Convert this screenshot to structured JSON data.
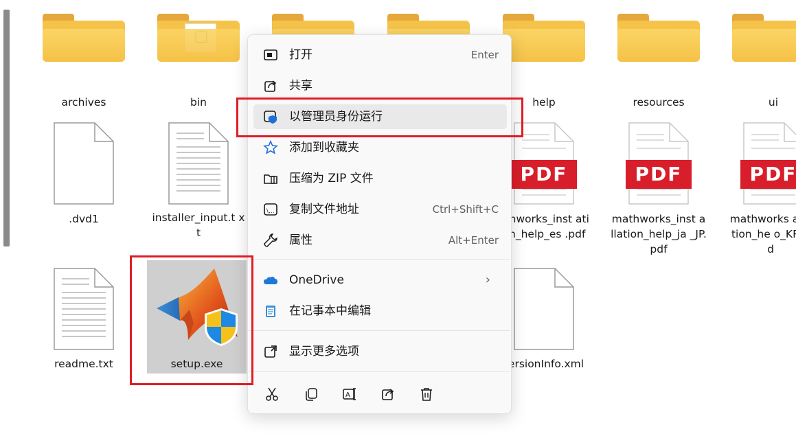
{
  "files": {
    "folders": [
      {
        "label": "archives"
      },
      {
        "label": "bin"
      },
      {
        "label": ""
      },
      {
        "label": ""
      },
      {
        "label": "help"
      },
      {
        "label": "resources"
      },
      {
        "label": "ui"
      }
    ],
    "dvd1": ".dvd1",
    "installer_input": "installer_input.t xt",
    "pdf_badge": "PDF",
    "pdf_es": "athworks_inst ation_help_es .pdf",
    "pdf_ja": "mathworks_inst allation_help_ja _JP.pdf",
    "pdf_ko": "mathworks allation_he o_KR.pd",
    "readme": "readme.txt",
    "setup": "setup.exe",
    "versioninfo": "ersionInfo.xml"
  },
  "context_menu": {
    "items": [
      {
        "icon": "open-icon",
        "label": "打开",
        "shortcut": "Enter"
      },
      {
        "icon": "share-icon",
        "label": "共享",
        "shortcut": ""
      },
      {
        "icon": "admin-shield-icon",
        "label": "以管理员身份运行",
        "shortcut": ""
      },
      {
        "icon": "star-icon",
        "label": "添加到收藏夹",
        "shortcut": ""
      },
      {
        "icon": "zip-icon",
        "label": "压缩为 ZIP 文件",
        "shortcut": ""
      },
      {
        "icon": "copy-path-icon",
        "label": "复制文件地址",
        "shortcut": "Ctrl+Shift+C"
      },
      {
        "icon": "wrench-icon",
        "label": "属性",
        "shortcut": "Alt+Enter"
      },
      {
        "icon": "onedrive-icon",
        "label": "OneDrive",
        "shortcut": ""
      },
      {
        "icon": "notepad-icon",
        "label": "在记事本中编辑",
        "shortcut": ""
      },
      {
        "icon": "more-options-icon",
        "label": "显示更多选项",
        "shortcut": ""
      }
    ],
    "onedrive_arrow": "›",
    "quick_actions": [
      "cut-icon",
      "copy-icon",
      "rename-icon",
      "share-icon",
      "delete-icon"
    ]
  },
  "colors": {
    "highlight_box": "#e01b24",
    "pdf_red": "#d81e2a",
    "folder_yellow": "#f6c34a",
    "selection_bg": "#cfcfcf"
  }
}
